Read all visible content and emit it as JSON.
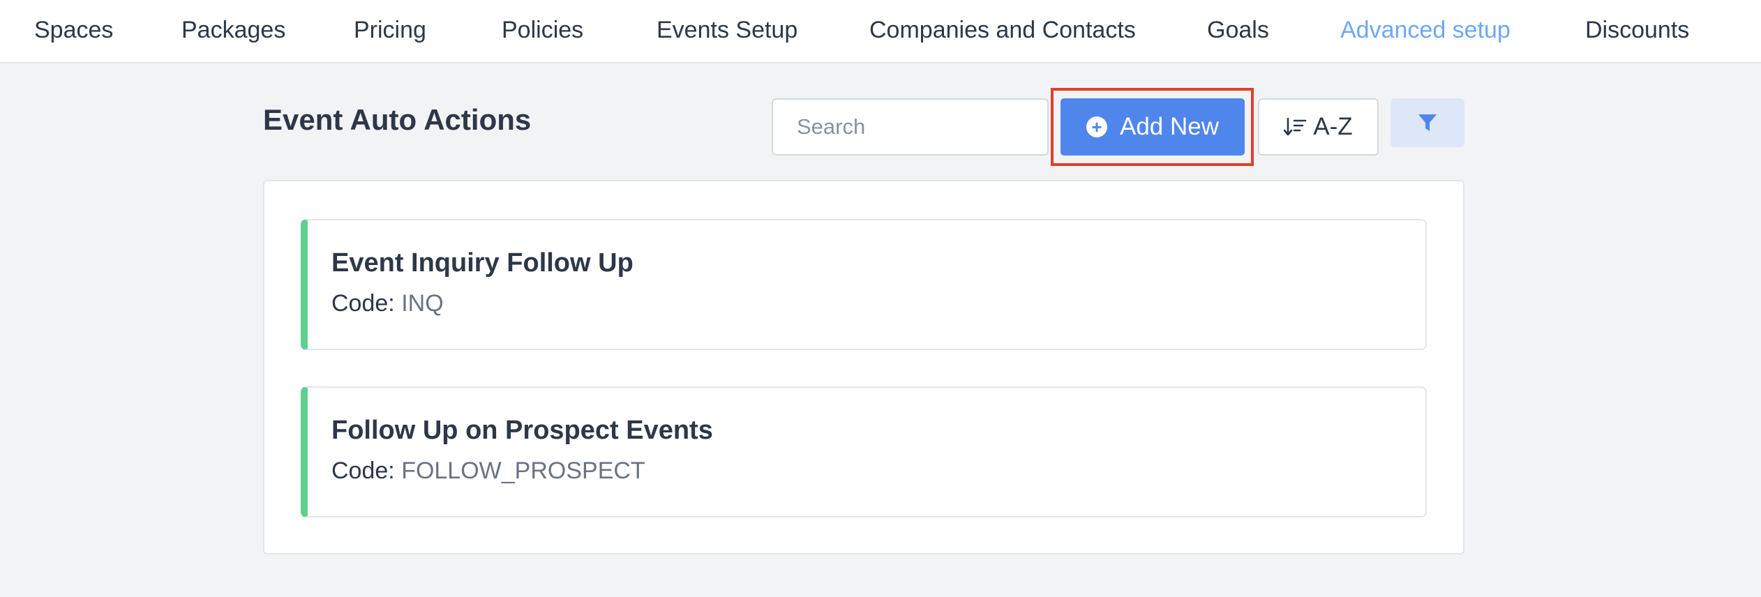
{
  "nav": {
    "items": [
      {
        "label": "Spaces",
        "active": false
      },
      {
        "label": "Packages",
        "active": false
      },
      {
        "label": "Pricing",
        "active": false
      },
      {
        "label": "Policies",
        "active": false
      },
      {
        "label": "Events Setup",
        "active": false
      },
      {
        "label": "Companies and Contacts",
        "active": false
      },
      {
        "label": "Goals",
        "active": false
      },
      {
        "label": "Advanced setup",
        "active": true
      },
      {
        "label": "Discounts",
        "active": false
      }
    ]
  },
  "page": {
    "title": "Event Auto Actions"
  },
  "toolbar": {
    "search_placeholder": "Search",
    "search_value": "",
    "add_label": "Add New",
    "sort_label": "A-Z",
    "add_icon": "plus-circle-icon",
    "sort_icon": "sort-descending-icon",
    "filter_icon": "filter-icon"
  },
  "items": [
    {
      "title": "Event Inquiry Follow Up",
      "code_label": "Code:",
      "code": "INQ"
    },
    {
      "title": "Follow Up on Prospect Events",
      "code_label": "Code:",
      "code": "FOLLOW_PROSPECT"
    }
  ],
  "colors": {
    "accent": "#4f86ec",
    "active_nav": "#6ea8f0",
    "card_stripe": "#5fcf8f",
    "highlight": "#e0402c",
    "filter_bg": "#dde7f8"
  }
}
